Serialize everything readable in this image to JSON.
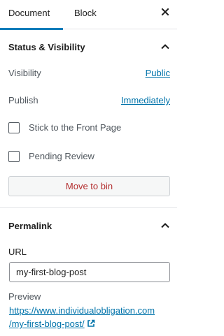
{
  "tabs": {
    "document": "Document",
    "block": "Block"
  },
  "status_visibility": {
    "title": "Status & Visibility",
    "visibility_label": "Visibility",
    "visibility_value": "Public",
    "publish_label": "Publish",
    "publish_value": "Immediately",
    "sticky_label": "Stick to the Front Page",
    "sticky_checked": false,
    "pending_label": "Pending Review",
    "pending_checked": false,
    "move_to_bin": "Move to bin"
  },
  "permalink": {
    "title": "Permalink",
    "url_label": "URL",
    "url_value": "my-first-blog-post",
    "preview_label": "Preview",
    "preview_line1": "https://www.individualobligation.com",
    "preview_line2": "/my-first-blog-post/"
  },
  "colors": {
    "accent": "#007cba",
    "link": "#0073aa",
    "danger": "#b32d2e"
  },
  "icons": {
    "close": "close-icon",
    "collapse": "chevron-up-icon",
    "external": "external-link-icon"
  }
}
